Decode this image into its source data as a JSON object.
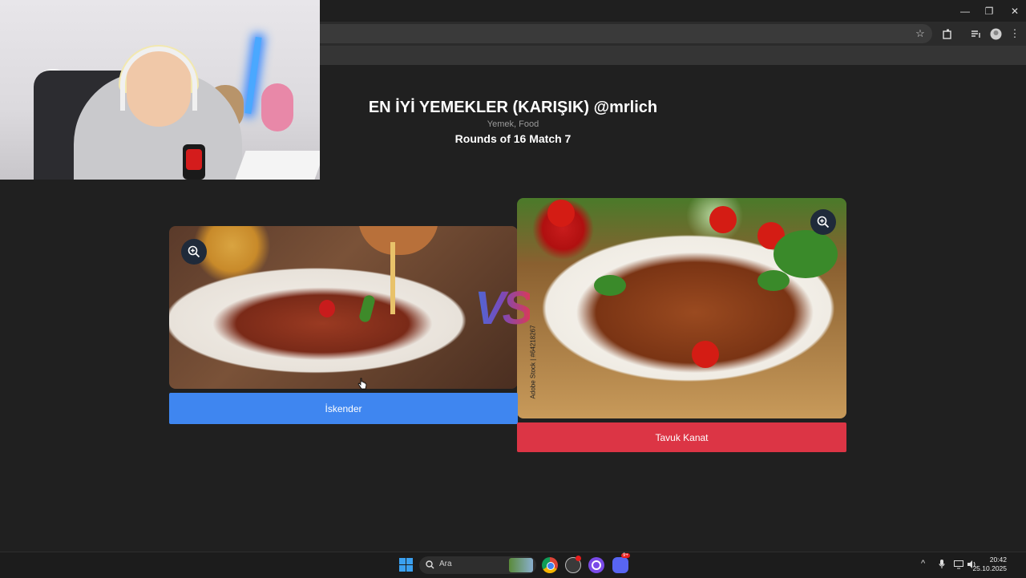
{
  "browser": {
    "window_controls": {
      "minimize": "—",
      "maximize": "❐",
      "close": "✕"
    },
    "toolbar_icons": [
      "star-icon",
      "extensions-icon",
      "media-icon",
      "profile-icon",
      "menu-icon"
    ]
  },
  "page": {
    "title": "EN İYİ YEMEKLER (KARIŞIK) @mrlich",
    "subtitle": "Yemek, Food",
    "round": "Rounds of 16 Match 7",
    "vs_text": "VS",
    "left_choice": {
      "label": "İskender",
      "color": "#3f86f0"
    },
    "right_choice": {
      "label": "Tavuk Kanat",
      "color": "#dc3545",
      "watermark": "Adobe Stock | #64218267"
    }
  },
  "taskbar": {
    "search_label": "Ara",
    "time": "20:42",
    "date": "25.10.2025",
    "apps": [
      "windows-start-icon",
      "chrome-icon",
      "app-icon",
      "circle-app-icon",
      "discord-icon"
    ],
    "discord_badge": "9+"
  }
}
